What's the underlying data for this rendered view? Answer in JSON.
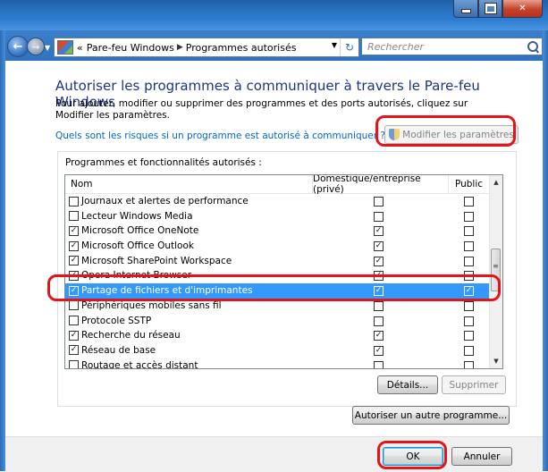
{
  "navigation": {
    "breadcrumb_prefix": "«",
    "breadcrumb_1": "Pare-feu Windows",
    "breadcrumb_2": "Programmes autorisés",
    "search_placeholder": "Rechercher"
  },
  "page": {
    "heading": "Autoriser les programmes à communiquer à travers le Pare-feu Windows",
    "description": "Pour ajouter, modifier ou supprimer des programmes et des ports autorisés, cliquez sur Modifier les paramètres.",
    "risk_link": "Quels sont les risques si un programme est autorisé à communiquer ?",
    "modify_button": "Modifier les paramètres"
  },
  "programs": {
    "group_label": "Programmes et fonctionnalités autorisés :",
    "columns": {
      "name": "Nom",
      "domestic": "Domestique/entreprise (privé)",
      "public": "Public"
    },
    "rows": [
      {
        "name": "Journaux et alertes de performance",
        "enabled": false,
        "private": false,
        "public": false
      },
      {
        "name": "Lecteur Windows Media",
        "enabled": false,
        "private": false,
        "public": false
      },
      {
        "name": "Microsoft Office OneNote",
        "enabled": true,
        "private": true,
        "public": false
      },
      {
        "name": "Microsoft Office Outlook",
        "enabled": true,
        "private": true,
        "public": false
      },
      {
        "name": "Microsoft SharePoint Workspace",
        "enabled": true,
        "private": true,
        "public": false
      },
      {
        "name": "Opera Internet Browser",
        "enabled": true,
        "private": true,
        "public": false
      },
      {
        "name": "Partage de fichiers et d'imprimantes",
        "enabled": true,
        "private": true,
        "public": true,
        "selected": true
      },
      {
        "name": "Périphériques mobiles sans fil",
        "enabled": false,
        "private": false,
        "public": false
      },
      {
        "name": "Protocole SSTP",
        "enabled": false,
        "private": false,
        "public": false
      },
      {
        "name": "Recherche du réseau",
        "enabled": true,
        "private": true,
        "public": false
      },
      {
        "name": "Réseau de base",
        "enabled": true,
        "private": true,
        "public": false
      },
      {
        "name": "Routage et accès distant",
        "enabled": false,
        "private": false,
        "public": false
      }
    ],
    "details_button": "Détails...",
    "remove_button": "Supprimer",
    "add_program_button": "Autoriser un autre programme..."
  },
  "footer": {
    "ok_button": "OK",
    "cancel_button": "Annuler"
  },
  "colors": {
    "title_blue": "#1e3287",
    "link_blue": "#0066cc",
    "selection": "#3399ff",
    "highlight_red": "#e4141b"
  }
}
